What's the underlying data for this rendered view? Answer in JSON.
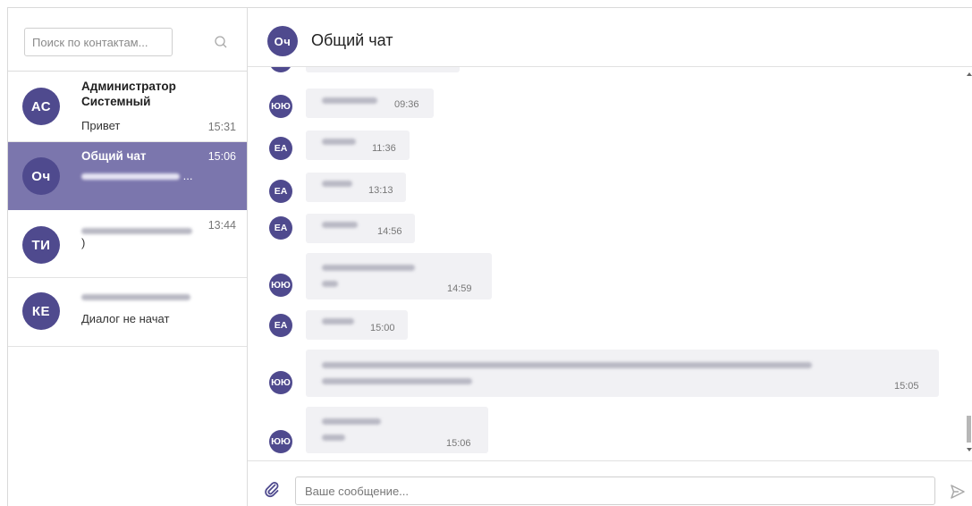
{
  "sidebar": {
    "search": {
      "placeholder": "Поиск по контактам...",
      "icon": "search-icon"
    },
    "contacts": [
      {
        "initials": "АС",
        "name": "Администратор Системный",
        "last_message": "Привет",
        "time": "15:31",
        "active": false
      },
      {
        "initials": "Оч",
        "name": "Общий чат",
        "last_message": "",
        "time": "15:06",
        "active": true
      },
      {
        "initials": "ТИ",
        "name": "",
        "last_message": ")",
        "time": "13:44",
        "active": false
      },
      {
        "initials": "КЕ",
        "name": "",
        "last_message": "Диалог не начат",
        "time": "",
        "active": false
      }
    ]
  },
  "chat": {
    "header": {
      "initials": "Оч",
      "title": "Общий чат"
    },
    "messages": [
      {
        "initials": "ЮЮ",
        "time": "09:36"
      },
      {
        "initials": "ЕА",
        "time": "11:36"
      },
      {
        "initials": "ЕА",
        "time": "13:13"
      },
      {
        "initials": "ЕА",
        "time": "14:56"
      },
      {
        "initials": "ЮЮ",
        "time": "14:59"
      },
      {
        "initials": "ЕА",
        "time": "15:00"
      },
      {
        "initials": "ЮЮ",
        "time": "15:05"
      },
      {
        "initials": "ЮЮ",
        "time": "15:06"
      }
    ],
    "composer": {
      "placeholder": "Ваше сообщение...",
      "attach_icon": "paperclip-icon",
      "send_icon": "send-icon"
    }
  },
  "colors": {
    "accent": "#4f4a8e",
    "active_item": "#7b76ad",
    "bubble": "#f1f1f4"
  }
}
